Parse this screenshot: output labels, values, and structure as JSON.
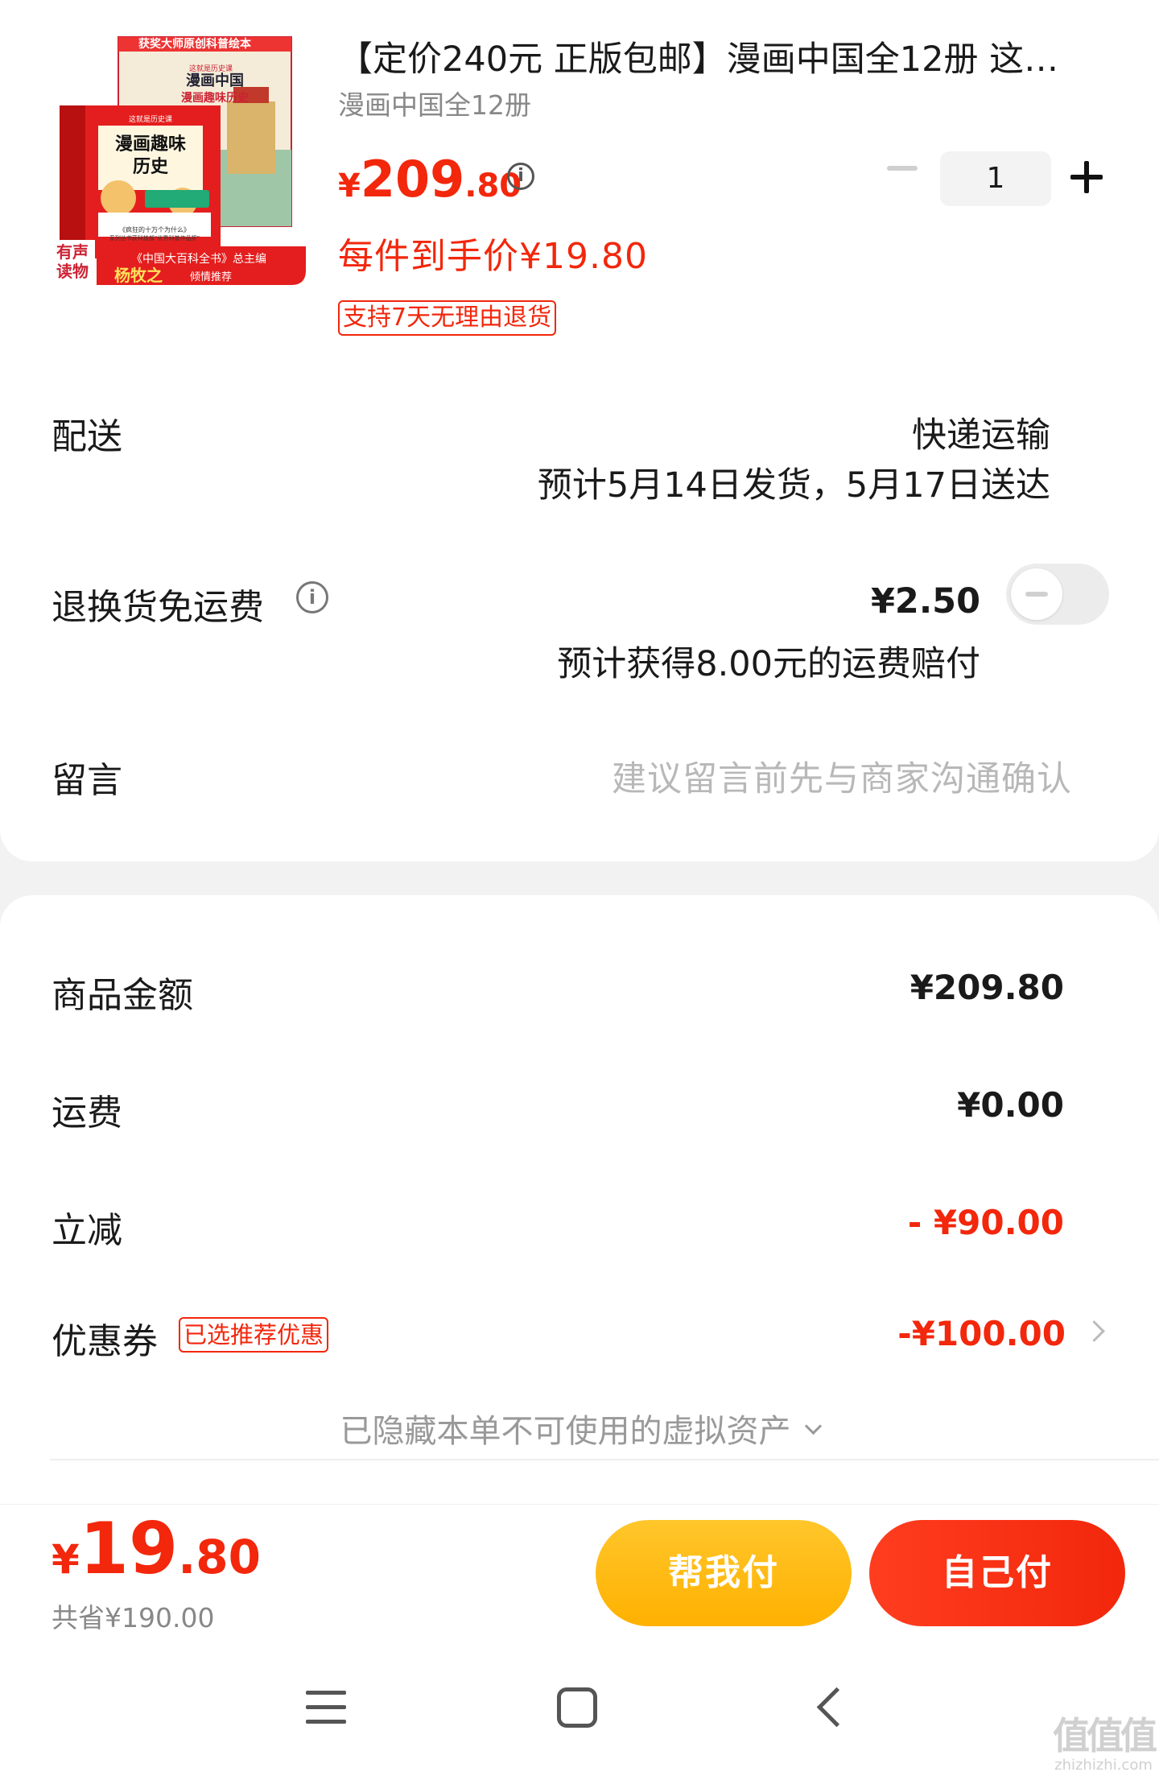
{
  "product": {
    "title": "【定价240元 正版包邮】漫画中国全12册 这…",
    "sku": "漫画中国全12册",
    "price_symbol": "¥",
    "price_int": "209",
    "price_dec": ".80",
    "unit_price": "每件到手价¥19.80",
    "return_policy": "支持7天无理由退货",
    "quantity": "1",
    "image": {
      "banner": "获奖大师原创科普绘本",
      "series_small": "这就是历史课",
      "box_title_back": "漫画中国",
      "box_subtitle_back": "漫画趣味历史",
      "box_title_front": "漫画趣味",
      "box_title_front2": "历史",
      "audio_badge_1": "有声",
      "audio_badge_2": "读物",
      "blurb_1": "《疯狂的十万个为什么》",
      "blurb_2": "系列丛书获科技部“优秀科普作品奖”",
      "editor_line": "《中国大百科全书》总主编",
      "editor_name": "杨牧之",
      "editor_tail": "倾情推荐"
    }
  },
  "delivery": {
    "label": "配送",
    "method": "快递运输",
    "eta": "预计5月14日发货，5月17日送达"
  },
  "refund_shipping": {
    "label": "退换货免运费",
    "price": "¥2.50",
    "note": "预计获得8.00元的运费赔付",
    "enabled": false
  },
  "message": {
    "label": "留言",
    "placeholder": "建议留言前先与商家沟通确认"
  },
  "summary": {
    "goods_label": "商品金额",
    "goods_value": "¥209.80",
    "shipping_label": "运费",
    "shipping_value": "¥0.00",
    "discount_label": "立减",
    "discount_value": "- ¥90.00",
    "coupon_label": "优惠券",
    "coupon_badge": "已选推荐优惠",
    "coupon_value": "-¥100.00",
    "hidden_assets": "已隐藏本单不可使用的虚拟资产"
  },
  "footer": {
    "total_symbol": "¥",
    "total_int": "19",
    "total_dec": ".80",
    "saved": "共省¥190.00",
    "help_pay": "帮我付",
    "self_pay": "自己付"
  },
  "watermark": {
    "logo": "值值值",
    "url": "zhizhizhi.com"
  },
  "colors": {
    "accent": "#f2270c",
    "help_button": "#ffb100",
    "self_button": "#f2270c"
  }
}
